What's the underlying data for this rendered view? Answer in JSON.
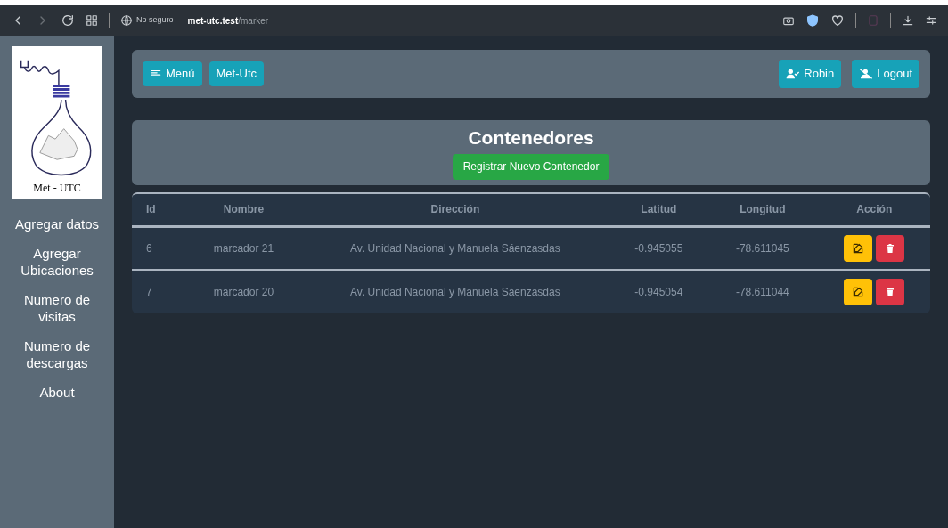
{
  "browser": {
    "security": "No seguro",
    "url_host": "met-utc.test",
    "url_path": "/marker"
  },
  "sidebar": {
    "logo_text": "Met - UTC",
    "items": [
      "Agregar datos",
      "Agregar Ubicaciones",
      "Numero de visitas",
      "Numero de descargas",
      "About"
    ]
  },
  "navbar": {
    "left_buttons": [
      "Menú",
      "Met-Utc"
    ],
    "user": "Robin",
    "logout": "Logout"
  },
  "page": {
    "title": "Contenedores",
    "new_button": "Registrar Nuevo Contenedor"
  },
  "table": {
    "columns": [
      "Id",
      "Nombre",
      "Dirección",
      "Latitud",
      "Longitud",
      "Acción"
    ],
    "rows": [
      {
        "id": "6",
        "nombre": "marcador 21",
        "direccion": "Av. Unidad Nacional y Manuela Sáenzasdas",
        "latitud": "-0.945055",
        "longitud": "-78.611045"
      },
      {
        "id": "7",
        "nombre": "marcador 20",
        "direccion": "Av. Unidad Nacional y Manuela Sáenzasdas",
        "latitud": "-0.945054",
        "longitud": "-78.611044"
      }
    ]
  }
}
